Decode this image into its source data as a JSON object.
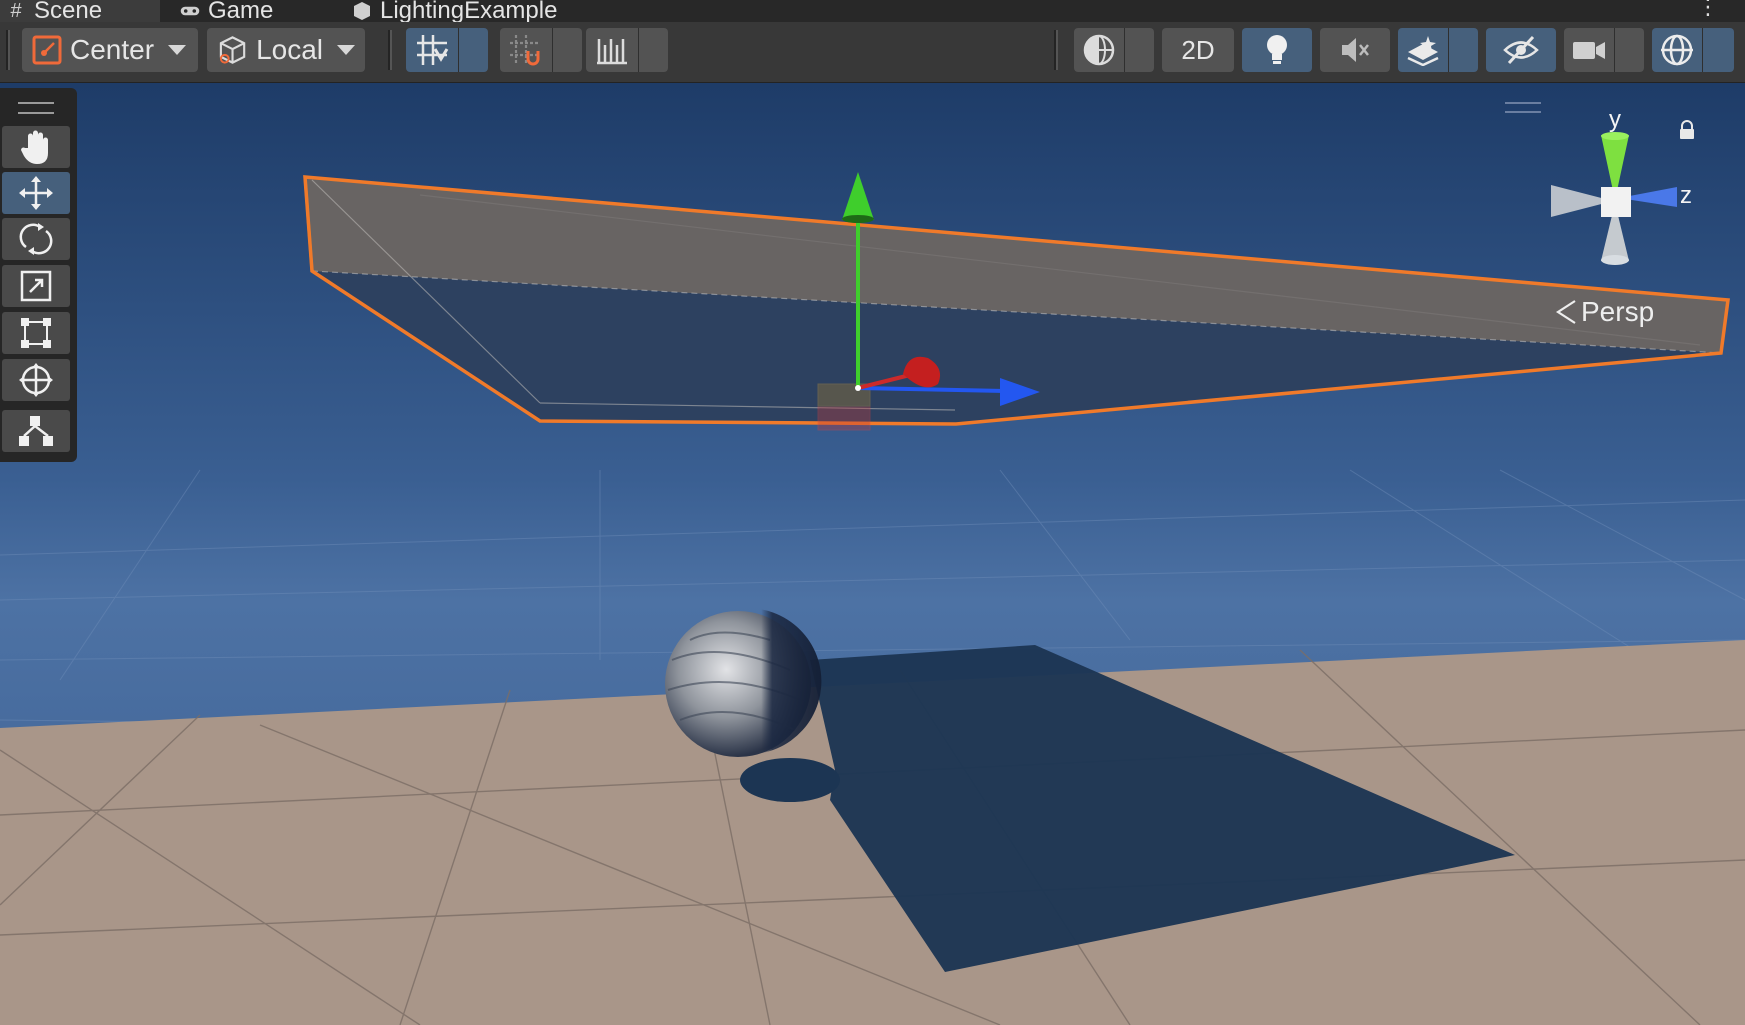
{
  "tabs": [
    {
      "label": "Scene",
      "icon": "hash-icon",
      "active": true
    },
    {
      "label": "Game",
      "icon": "gamepad-icon",
      "active": false
    },
    {
      "label": "LightingExample",
      "icon": "unity-scene-icon",
      "active": false
    }
  ],
  "toolbar": {
    "pivot_mode": "Center",
    "pivot_rotation": "Local",
    "view_2d": "2D"
  },
  "tools": [
    "hand-tool",
    "move-tool",
    "rotate-tool",
    "scale-tool",
    "rect-tool",
    "transform-tool",
    "custom-editor-tool"
  ],
  "active_tool": "move-tool",
  "gizmo": {
    "axis_y": "y",
    "axis_z": "z",
    "projection": "Persp"
  },
  "colors": {
    "selection_outline": "#f07a2a",
    "axis_x": "#d02020",
    "axis_y": "#40d030",
    "axis_z": "#2050f0",
    "toolbar_active": "#46607c",
    "sky_top": "#23426f",
    "ground": "#a9968a",
    "shadow": "#1b3452"
  }
}
